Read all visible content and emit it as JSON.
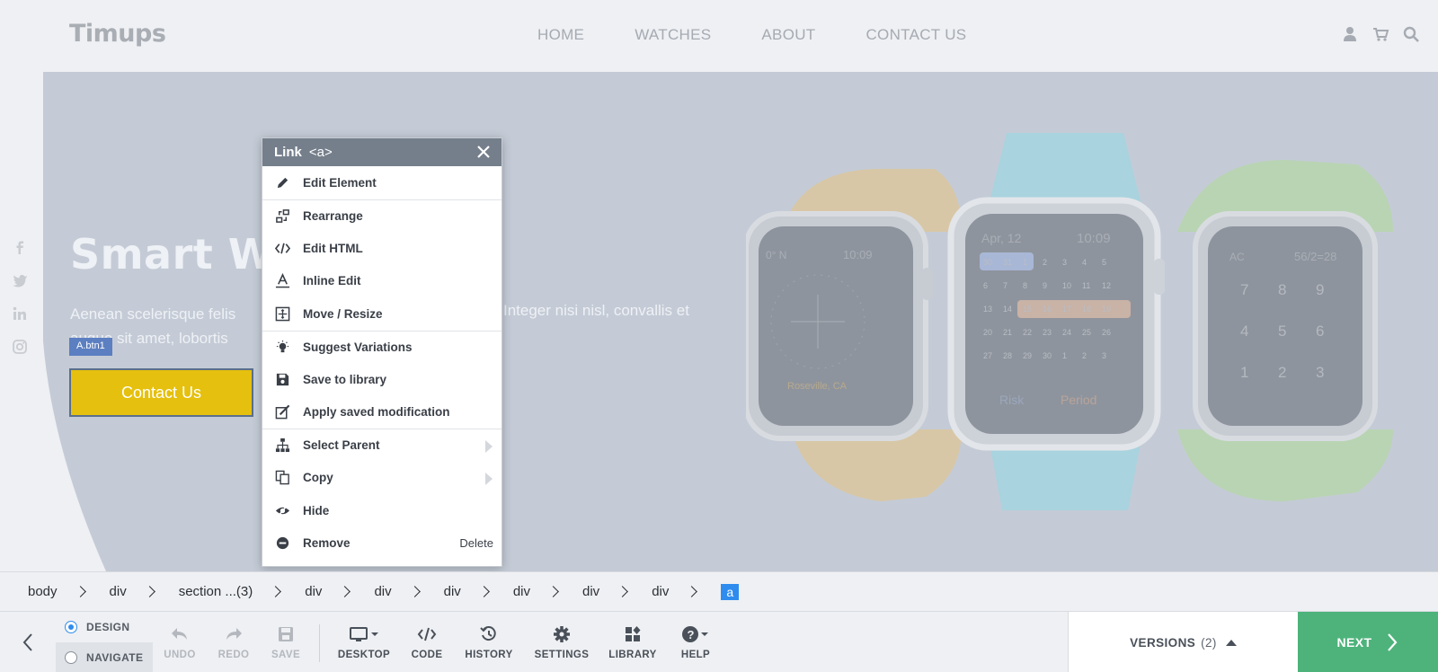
{
  "site": {
    "logo": "Timups",
    "nav": [
      "HOME",
      "WATCHES",
      "ABOUT",
      "CONTACT US"
    ]
  },
  "hero": {
    "title": "Smart Wa",
    "text_left_1": "Aenean scelerisque felis",
    "text_left_2": "augue sit amet, lobortis",
    "text_right": "Integer nisi nisl, convallis et",
    "selection_tag": "A.btn1",
    "button": "Contact Us",
    "watch_left": {
      "label": "0° N",
      "time": "10:09",
      "city": "Roseville, CA"
    },
    "watch_mid": {
      "date": "Apr, 12",
      "time": "10:09",
      "risk": "Risk",
      "period": "Period",
      "cal": [
        "30",
        "31",
        "1",
        "2",
        "3",
        "4",
        "5",
        "6",
        "7",
        "8",
        "9",
        "10",
        "11",
        "12",
        "13",
        "14",
        "15",
        "16",
        "17",
        "18",
        "19",
        "20",
        "21",
        "22",
        "23",
        "24",
        "25",
        "26",
        "27",
        "28",
        "29",
        "30",
        "1",
        "2",
        "3"
      ]
    },
    "watch_right": {
      "label": "AC",
      "value": "56/2=28",
      "keys": [
        "7",
        "8",
        "9",
        "4",
        "5",
        "6",
        "1",
        "2",
        "3"
      ]
    }
  },
  "context_menu": {
    "title": "Link",
    "tag": "<a>",
    "items": [
      {
        "label": "Edit Element",
        "icon": "pencil-icon"
      },
      {
        "label": "Rearrange",
        "icon": "rearrange-icon"
      },
      {
        "label": "Edit HTML",
        "icon": "code-icon"
      },
      {
        "label": "Inline Edit",
        "icon": "text-edit-icon"
      },
      {
        "label": "Move / Resize",
        "icon": "move-icon"
      },
      {
        "label": "Suggest Variations",
        "icon": "lightbulb-icon"
      },
      {
        "label": "Save to library",
        "icon": "save-icon"
      },
      {
        "label": "Apply saved modification",
        "icon": "apply-icon"
      },
      {
        "label": "Select Parent",
        "icon": "sitemap-icon"
      },
      {
        "label": "Copy",
        "icon": "copy-icon"
      },
      {
        "label": "Hide",
        "icon": "eye-slash-icon"
      },
      {
        "label": "Remove",
        "icon": "minus-circle-icon",
        "shortcut": "Delete"
      }
    ]
  },
  "breadcrumb": [
    "body",
    "div",
    "section ...(3)",
    "div",
    "div",
    "div",
    "div",
    "div",
    "div",
    "a"
  ],
  "toolbar": {
    "design": "DESIGN",
    "navigate": "NAVIGATE",
    "undo": "UNDO",
    "redo": "REDO",
    "save": "SAVE",
    "desktop": "DESKTOP",
    "code": "CODE",
    "history": "HISTORY",
    "settings": "SETTINGS",
    "library": "LIBRARY",
    "help": "HELP",
    "versions": "VERSIONS",
    "versions_count": "(2)",
    "next": "NEXT"
  },
  "colors": {
    "accent": "#2f8cef",
    "next": "#4db37b",
    "button": "#e5c00e"
  }
}
